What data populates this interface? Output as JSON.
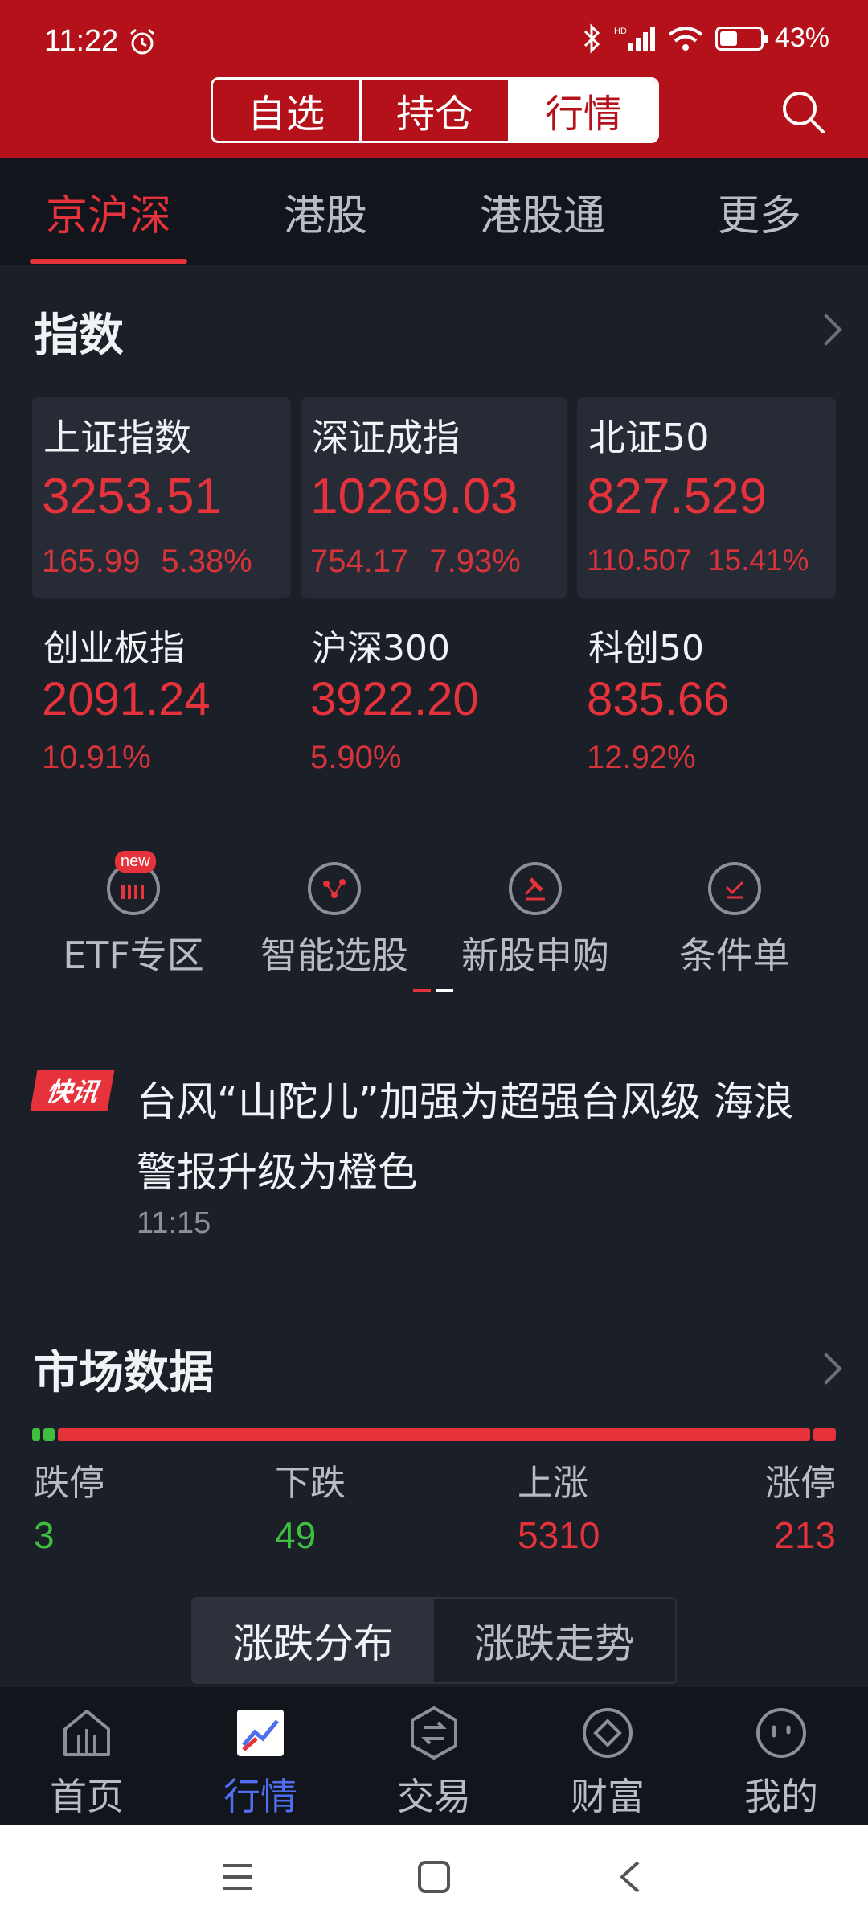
{
  "status": {
    "time": "11:22",
    "battery": "43%",
    "battery_level": 0.43
  },
  "header": {
    "segments": [
      "自选",
      "持仓",
      "行情"
    ],
    "active_segment": 2
  },
  "subtabs": [
    "京沪深",
    "港股",
    "港股通",
    "更多"
  ],
  "index": {
    "title": "指数",
    "items": [
      {
        "name": "上证指数",
        "value": "3253.51",
        "change": "165.99",
        "pct": "5.38%"
      },
      {
        "name": "深证成指",
        "value": "10269.03",
        "change": "754.17",
        "pct": "7.93%"
      },
      {
        "name": "北证50",
        "value": "827.529",
        "change": "110.507",
        "pct": "15.41%"
      },
      {
        "name": "创业板指",
        "value": "2091.24",
        "pct": "10.91%"
      },
      {
        "name": "沪深300",
        "value": "3922.20",
        "pct": "5.90%"
      },
      {
        "name": "科创50",
        "value": "835.66",
        "pct": "12.92%"
      }
    ]
  },
  "menu": {
    "items": [
      {
        "label": "ETF专区",
        "badge": "new"
      },
      {
        "label": "智能选股"
      },
      {
        "label": "新股申购"
      },
      {
        "label": "条件单"
      }
    ]
  },
  "news": {
    "badge": "快讯",
    "text": "台风“山陀儿”加强为超强台风级 海浪警报升级为橙色",
    "time": "11:15"
  },
  "market": {
    "title": "市场数据",
    "stats": [
      {
        "label": "跌停",
        "value": "3"
      },
      {
        "label": "下跌",
        "value": "49"
      },
      {
        "label": "上涨",
        "value": "5310"
      },
      {
        "label": "涨停",
        "value": "213"
      }
    ],
    "toggle": [
      "涨跌分布",
      "涨跌走势"
    ]
  },
  "nav": [
    "首页",
    "行情",
    "交易",
    "财富",
    "我的"
  ],
  "colors": {
    "red": "#e5323b",
    "green": "#3fbf3f",
    "accent_blue": "#4f6ff0",
    "header_red": "#b5111a"
  }
}
